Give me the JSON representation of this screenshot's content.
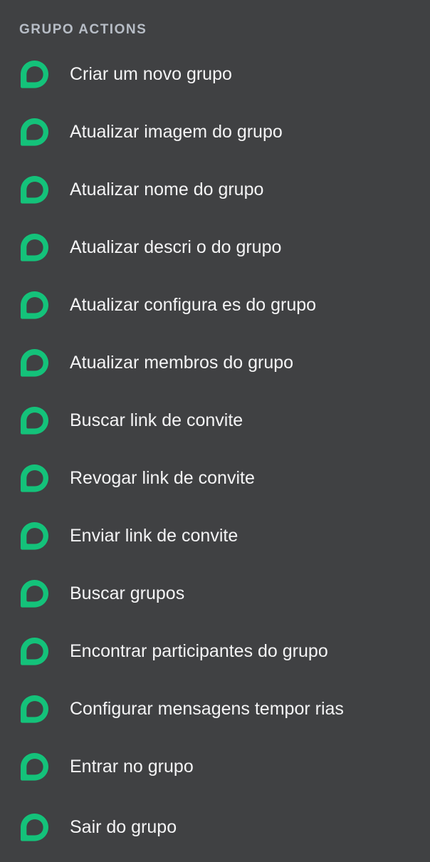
{
  "section": {
    "title": "GRUPO ACTIONS"
  },
  "colors": {
    "background": "#404143",
    "icon_green": "#14c27a",
    "header_text": "#b7bdc6",
    "item_text": "#f4f4f5"
  },
  "actions": [
    {
      "label": "Criar um novo grupo",
      "icon": "chat-bubble-icon"
    },
    {
      "label": "Atualizar imagem do grupo",
      "icon": "chat-bubble-icon"
    },
    {
      "label": "Atualizar nome do grupo",
      "icon": "chat-bubble-icon"
    },
    {
      "label": "Atualizar descri o do grupo",
      "icon": "chat-bubble-icon"
    },
    {
      "label": "Atualizar configura es do grupo",
      "icon": "chat-bubble-icon"
    },
    {
      "label": "Atualizar membros do grupo",
      "icon": "chat-bubble-icon"
    },
    {
      "label": "Buscar link de convite",
      "icon": "chat-bubble-icon"
    },
    {
      "label": "Revogar link de convite",
      "icon": "chat-bubble-icon"
    },
    {
      "label": "Enviar link de convite",
      "icon": "chat-bubble-icon"
    },
    {
      "label": "Buscar grupos",
      "icon": "chat-bubble-icon"
    },
    {
      "label": "Encontrar participantes do grupo",
      "icon": "chat-bubble-icon"
    },
    {
      "label": "Configurar mensagens tempor rias",
      "icon": "chat-bubble-icon"
    },
    {
      "label": "Entrar no grupo",
      "icon": "chat-bubble-icon"
    },
    {
      "label": "Sair do grupo",
      "icon": "chat-bubble-icon"
    }
  ]
}
